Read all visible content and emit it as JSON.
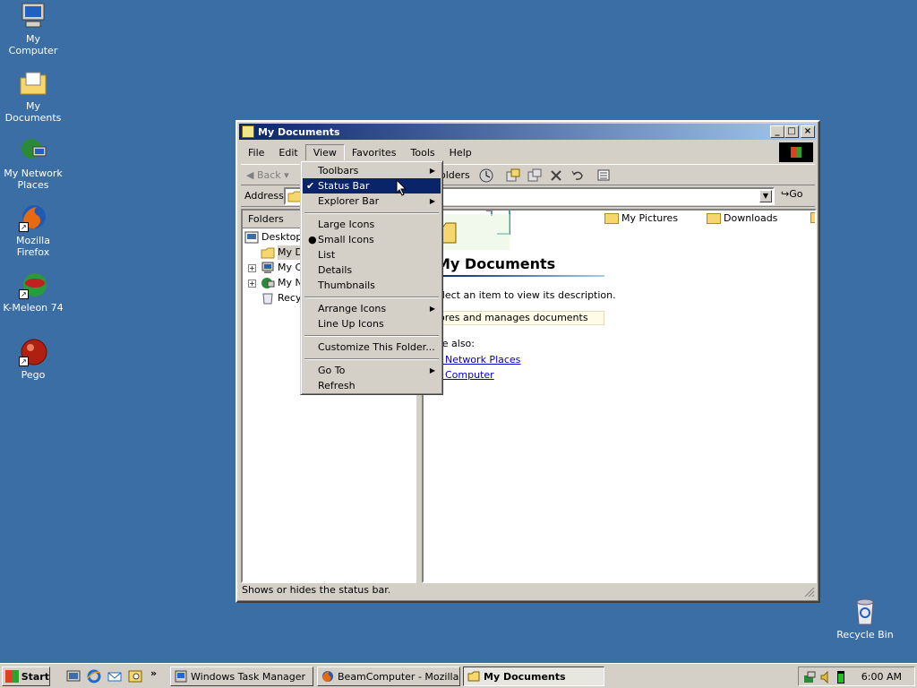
{
  "desktop": {
    "icons": [
      {
        "label": "My Computer",
        "icon": "computer-icon"
      },
      {
        "label": "My Documents",
        "icon": "documents-folder-icon"
      },
      {
        "label": "My Network Places",
        "icon": "network-icon"
      },
      {
        "label": "Mozilla Firefox",
        "icon": "firefox-icon"
      },
      {
        "label": "K-Meleon 74",
        "icon": "kmeleon-icon"
      },
      {
        "label": "Pego",
        "icon": "pego-icon"
      },
      {
        "label": "Recycle Bin",
        "icon": "recycle-bin-icon"
      }
    ]
  },
  "window": {
    "title": "My Documents",
    "menu": [
      "File",
      "Edit",
      "View",
      "Favorites",
      "Tools",
      "Help"
    ],
    "toolbar": {
      "back": "Back",
      "folders": "olders"
    },
    "address": {
      "label": "Address",
      "go": "Go"
    },
    "folders_pane": {
      "title": "Folders",
      "items": [
        "Desktop",
        "My Do",
        "My Co",
        "My Ne",
        "Recyc"
      ]
    },
    "content": {
      "files": [
        "My Pictures",
        "Downloads"
      ],
      "title": "My Documents",
      "description": "elect an item to view its description.",
      "note": "ores and manages documents",
      "see_also": "ee also:",
      "links": [
        "y Network Places",
        "y Computer"
      ]
    },
    "status": "Shows or hides the status bar."
  },
  "view_menu": {
    "groups": [
      [
        {
          "label": "Toolbars",
          "submenu": true
        },
        {
          "label": "Status Bar",
          "checked": true,
          "highlighted": true
        },
        {
          "label": "Explorer Bar",
          "submenu": true
        }
      ],
      [
        {
          "label": "Large Icons"
        },
        {
          "label": "Small Icons",
          "radio": true
        },
        {
          "label": "List"
        },
        {
          "label": "Details"
        },
        {
          "label": "Thumbnails"
        }
      ],
      [
        {
          "label": "Arrange Icons",
          "submenu": true
        },
        {
          "label": "Line Up Icons"
        }
      ],
      [
        {
          "label": "Customize This Folder..."
        }
      ],
      [
        {
          "label": "Go To",
          "submenu": true
        },
        {
          "label": "Refresh"
        }
      ]
    ]
  },
  "taskbar": {
    "start": "Start",
    "tasks": [
      "Windows Task Manager",
      "BeamComputer - Mozilla F...",
      "My Documents"
    ],
    "clock": "6:00 AM"
  },
  "colors": {
    "desktop": "#3a6ea5",
    "title_bar": "#0a246a",
    "menu_highlight": "#0a246a"
  }
}
